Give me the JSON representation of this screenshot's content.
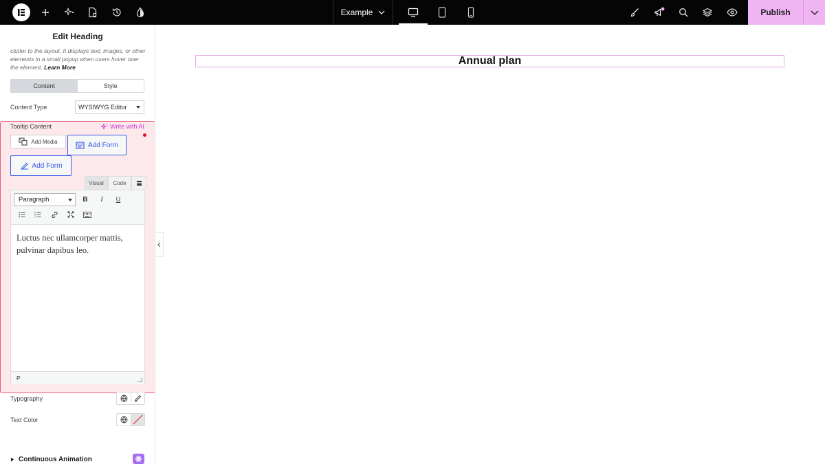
{
  "topbar": {
    "site_name": "Example",
    "publish_label": "Publish"
  },
  "panel": {
    "title": "Edit Heading",
    "description": "clutter to the layout. It displays text, images, or other elements in a small popup when users hover over the element.",
    "learn_more": "Learn More",
    "tabs": [
      "Content",
      "Style"
    ],
    "content_type_label": "Content Type",
    "content_type_value": "WYSIWYG Editor",
    "tooltip": {
      "label": "Tooltip Content",
      "ai_label": "Write with AI",
      "add_media": "Add Media",
      "add_form_1": "Add Form",
      "add_form_2": "Add Form",
      "editor_tabs": [
        "Visual",
        "Code"
      ],
      "format_value": "Paragraph",
      "content": "Luctus nec ullamcorper mattis, pulvinar dapibus leo.",
      "status_path": "P"
    },
    "typography_label": "Typography",
    "text_color_label": "Text Color",
    "continuous_animation": "Continuous Animation"
  },
  "canvas": {
    "heading": "Annual plan"
  },
  "colors": {
    "accent": "#f0b4f2",
    "ai": "#c93ad1",
    "form_button": "#3858e9",
    "section_border": "#e85b7a"
  }
}
